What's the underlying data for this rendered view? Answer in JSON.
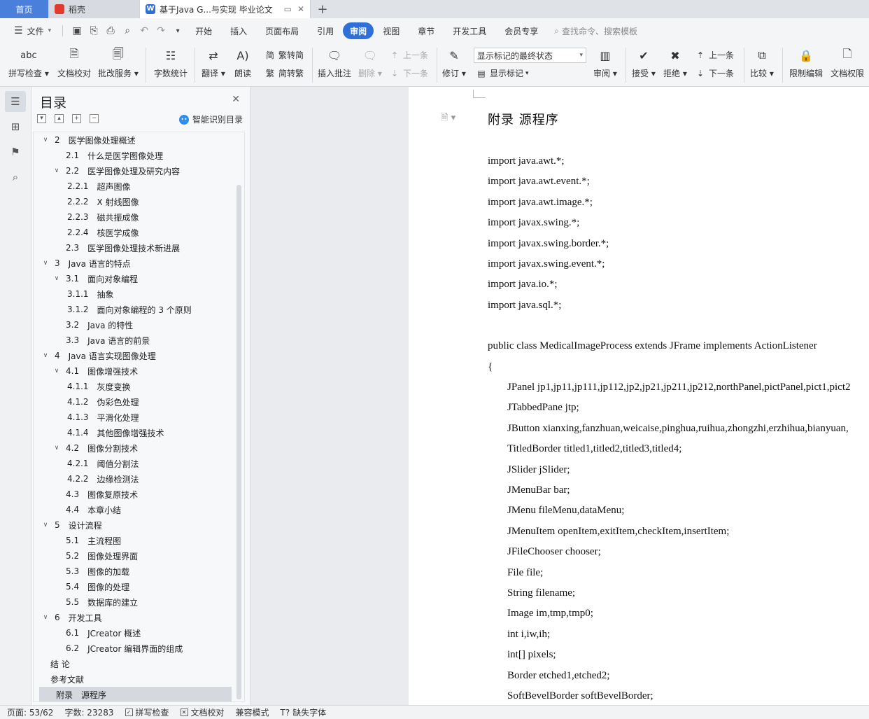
{
  "tabs": {
    "home": "首页",
    "daoke": "稻壳",
    "doc": "基于Java G...与实现 毕业论文",
    "new_tab": "+"
  },
  "menu": {
    "file": "文件",
    "tabs": [
      "开始",
      "插入",
      "页面布局",
      "引用",
      "审阅",
      "视图",
      "章节",
      "开发工具",
      "会员专享"
    ],
    "active_tab": "审阅",
    "search": "查找命令、搜索模板"
  },
  "ribbon": {
    "spell_check": "拼写检查",
    "doc_proof": "文档校对",
    "review_service": "批改服务",
    "word_count": "字数统计",
    "translate": "翻译",
    "read_aloud": "朗读",
    "to_traditional": "繁转简",
    "to_simplified": "简转繁",
    "insert_comment": "插入批注",
    "delete": "删除",
    "prev_comment": "上一条",
    "next_comment": "下一条",
    "revise": "修订",
    "markup_state": "显示标记的最终状态",
    "show_markup": "显示标记",
    "review": "审阅",
    "accept": "接受",
    "reject": "拒绝",
    "prev_change": "上一条",
    "next_change": "下一条",
    "compare": "比较",
    "restrict_edit": "限制编辑",
    "doc_permission": "文档权限"
  },
  "toc": {
    "title": "目录",
    "smart": "智能识别目录",
    "items": [
      {
        "num": "2",
        "text": "医学图像处理概述",
        "level": 1,
        "toggle": "v"
      },
      {
        "num": "2.1",
        "text": "什么是医学图像处理",
        "level": 2,
        "toggle": ""
      },
      {
        "num": "2.2",
        "text": "医学图像处理及研究内容",
        "level": 2,
        "toggle": "v"
      },
      {
        "num": "2.2.1",
        "text": "超声图像",
        "level": 3,
        "toggle": ""
      },
      {
        "num": "2.2.2",
        "text": "X 射线图像",
        "level": 3,
        "toggle": ""
      },
      {
        "num": "2.2.3",
        "text": "磁共振成像",
        "level": 3,
        "toggle": ""
      },
      {
        "num": "2.2.4",
        "text": "核医学成像",
        "level": 3,
        "toggle": ""
      },
      {
        "num": "2.3",
        "text": "医学图像处理技术新进展",
        "level": 2,
        "toggle": ""
      },
      {
        "num": "3",
        "text": "Java 语言的特点",
        "level": 1,
        "toggle": "v"
      },
      {
        "num": "3.1",
        "text": "面向对象编程",
        "level": 2,
        "toggle": "v"
      },
      {
        "num": "3.1.1",
        "text": "抽象",
        "level": 3,
        "toggle": ""
      },
      {
        "num": "3.1.2",
        "text": "面向对象编程的 3 个原则",
        "level": 3,
        "toggle": ""
      },
      {
        "num": "3.2",
        "text": "Java 的特性",
        "level": 2,
        "toggle": ""
      },
      {
        "num": "3.3",
        "text": "Java 语言的前景",
        "level": 2,
        "toggle": ""
      },
      {
        "num": "4",
        "text": "Java 语言实现图像处理",
        "level": 1,
        "toggle": "v"
      },
      {
        "num": "4.1",
        "text": "图像增强技术",
        "level": 2,
        "toggle": "v"
      },
      {
        "num": "4.1.1",
        "text": "灰度变换",
        "level": 3,
        "toggle": ""
      },
      {
        "num": "4.1.2",
        "text": "伪彩色处理",
        "level": 3,
        "toggle": ""
      },
      {
        "num": "4.1.3",
        "text": "平滑化处理",
        "level": 3,
        "toggle": ""
      },
      {
        "num": "4.1.4",
        "text": "其他图像增强技术",
        "level": 3,
        "toggle": ""
      },
      {
        "num": "4.2",
        "text": "图像分割技术",
        "level": 2,
        "toggle": "v"
      },
      {
        "num": "4.2.1",
        "text": "阈值分割法",
        "level": 3,
        "toggle": ""
      },
      {
        "num": "4.2.2",
        "text": "边缘检测法",
        "level": 3,
        "toggle": ""
      },
      {
        "num": "4.3",
        "text": "图像复原技术",
        "level": 2,
        "toggle": ""
      },
      {
        "num": "4.4",
        "text": "本章小结",
        "level": 2,
        "toggle": ""
      },
      {
        "num": "5",
        "text": "设计流程",
        "level": 1,
        "toggle": "v"
      },
      {
        "num": "5.1",
        "text": "主流程图",
        "level": 2,
        "toggle": ""
      },
      {
        "num": "5.2",
        "text": "图像处理界面",
        "level": 2,
        "toggle": ""
      },
      {
        "num": "5.3",
        "text": "图像的加载",
        "level": 2,
        "toggle": ""
      },
      {
        "num": "5.4",
        "text": "图像的处理",
        "level": 2,
        "toggle": ""
      },
      {
        "num": "5.5",
        "text": "数据库的建立",
        "level": 2,
        "toggle": ""
      },
      {
        "num": "6",
        "text": "开发工具",
        "level": 1,
        "toggle": "v"
      },
      {
        "num": "6.1",
        "text": "JCreator 概述",
        "level": 2,
        "toggle": ""
      },
      {
        "num": "6.2",
        "text": "JCreator 编辑界面的组成",
        "level": 2,
        "toggle": ""
      },
      {
        "num": "",
        "text": "结  论",
        "level": 0,
        "toggle": ""
      },
      {
        "num": "",
        "text": "参考文献",
        "level": 0,
        "toggle": ""
      },
      {
        "num": "附录",
        "text": "源程序",
        "level": 0,
        "toggle": "",
        "selected": true
      }
    ]
  },
  "document": {
    "title": "附录    源程序",
    "lines": [
      {
        "text": "import java.awt.*;",
        "indent": false
      },
      {
        "text": "import java.awt.event.*;",
        "indent": false
      },
      {
        "text": "import java.awt.image.*;",
        "indent": false
      },
      {
        "text": "import javax.swing.*;",
        "indent": false
      },
      {
        "text": "import javax.swing.border.*;",
        "indent": false
      },
      {
        "text": "import javax.swing.event.*;",
        "indent": false
      },
      {
        "text": "import java.io.*;",
        "indent": false
      },
      {
        "text": "import java.sql.*;",
        "indent": false
      },
      {
        "text": "",
        "indent": false
      },
      {
        "text": "public class  MedicalImageProcess extends JFrame implements ActionListener",
        "indent": false
      },
      {
        "text": "{",
        "indent": false
      },
      {
        "text": "JPanel jp1,jp11,jp111,jp112,jp2,jp21,jp211,jp212,northPanel,pictPanel,pict1,pict2",
        "indent": true
      },
      {
        "text": "JTabbedPane jtp;",
        "indent": true
      },
      {
        "text": "JButton xianxing,fanzhuan,weicaise,pinghua,ruihua,zhongzhi,erzhihua,bianyuan,",
        "indent": true
      },
      {
        "text": "TitledBorder titled1,titled2,titled3,titled4;",
        "indent": true
      },
      {
        "text": "JSlider jSlider;",
        "indent": true
      },
      {
        "text": "JMenuBar bar;",
        "indent": true
      },
      {
        "text": "JMenu fileMenu,dataMenu;",
        "indent": true
      },
      {
        "text": "JMenuItem openItem,exitItem,checkItem,insertItem;",
        "indent": true
      },
      {
        "text": "JFileChooser chooser;",
        "indent": true
      },
      {
        "text": "File file;",
        "indent": true
      },
      {
        "text": "String filename;",
        "indent": true
      },
      {
        "text": "Image im,tmp,tmp0;",
        "indent": true
      },
      {
        "text": "int i,iw,ih;",
        "indent": true
      },
      {
        "text": "int[] pixels;",
        "indent": true
      },
      {
        "text": "Border etched1,etched2;",
        "indent": true
      },
      {
        "text": "SoftBevelBorder softBevelBorder;",
        "indent": true
      }
    ]
  },
  "status": {
    "page": "页面: 53/62",
    "words": "字数: 23283",
    "spell": "拼写检查",
    "proof": "文档校对",
    "compat": "兼容模式",
    "missing_font": "缺失字体"
  }
}
